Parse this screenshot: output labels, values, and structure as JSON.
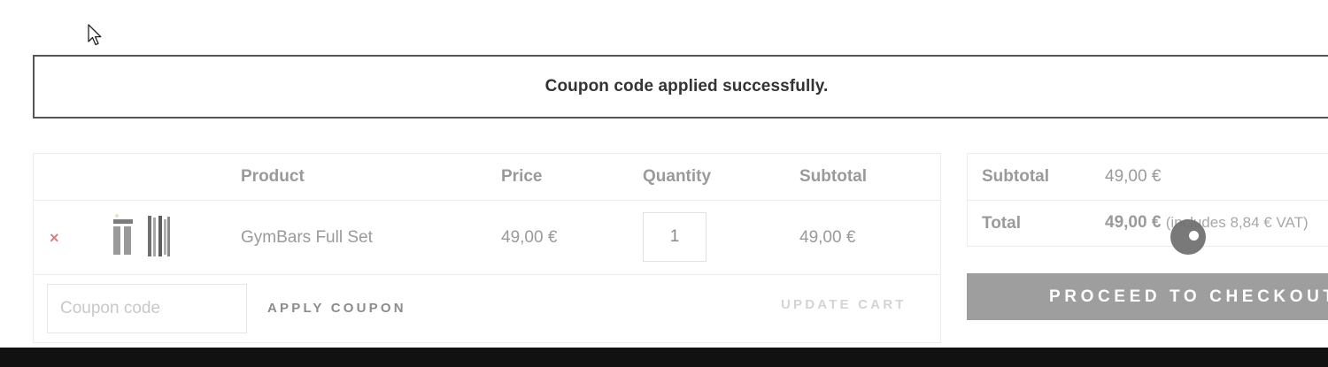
{
  "notice": {
    "message": "Coupon code applied successfully."
  },
  "cart": {
    "headers": {
      "product": "Product",
      "price": "Price",
      "quantity": "Quantity",
      "subtotal": "Subtotal"
    },
    "items": [
      {
        "remove_symbol": "×",
        "name": "GymBars Full Set",
        "price": "49,00 €",
        "quantity": "1",
        "subtotal": "49,00 €"
      }
    ],
    "coupon_placeholder": "Coupon code",
    "apply_coupon_label": "APPLY COUPON",
    "update_cart_label": "UPDATE CART"
  },
  "totals": {
    "subtotal_label": "Subtotal",
    "subtotal_value": "49,00 €",
    "total_label": "Total",
    "total_value": "49,00 €",
    "tax_note": "(includes 8,84 € VAT)",
    "checkout_label": "PROCEED TO CHECKOUT"
  }
}
